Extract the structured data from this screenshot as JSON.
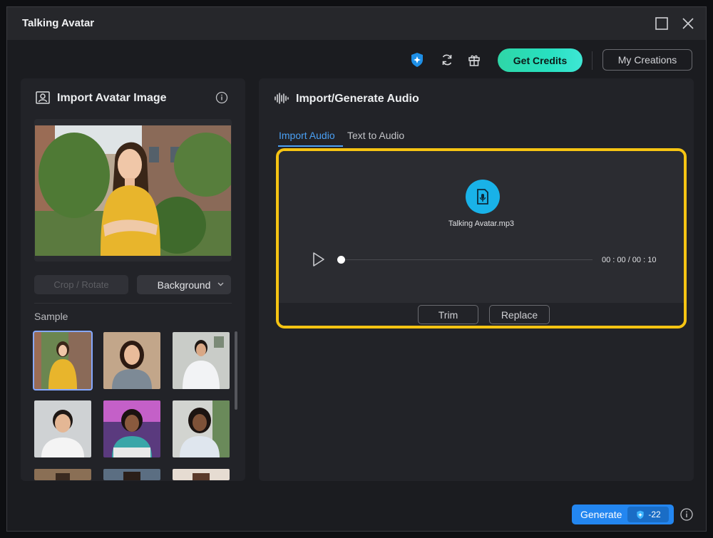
{
  "window": {
    "title": "Talking Avatar"
  },
  "toolbar": {
    "get_credits": "Get Credits",
    "my_creations": "My Creations"
  },
  "left_panel": {
    "title": "Import Avatar Image",
    "crop_rotate": "Crop / Rotate",
    "background": "Background",
    "sample_label": "Sample"
  },
  "right_panel": {
    "title": "Import/Generate Audio",
    "tabs": [
      "Import Audio",
      "Text to Audio"
    ],
    "active_tab": "Import Audio",
    "file_name": "Talking Avatar.mp3",
    "time": "00 : 00 / 00 : 10",
    "progress": 0,
    "trim": "Trim",
    "replace": "Replace"
  },
  "footer": {
    "generate": "Generate",
    "credit_cost": "-22"
  },
  "colors": {
    "accent": "#4aa0f4",
    "highlight": "#f6c413",
    "credits_green": "#2fd6a7",
    "generate_blue": "#2386f0"
  }
}
